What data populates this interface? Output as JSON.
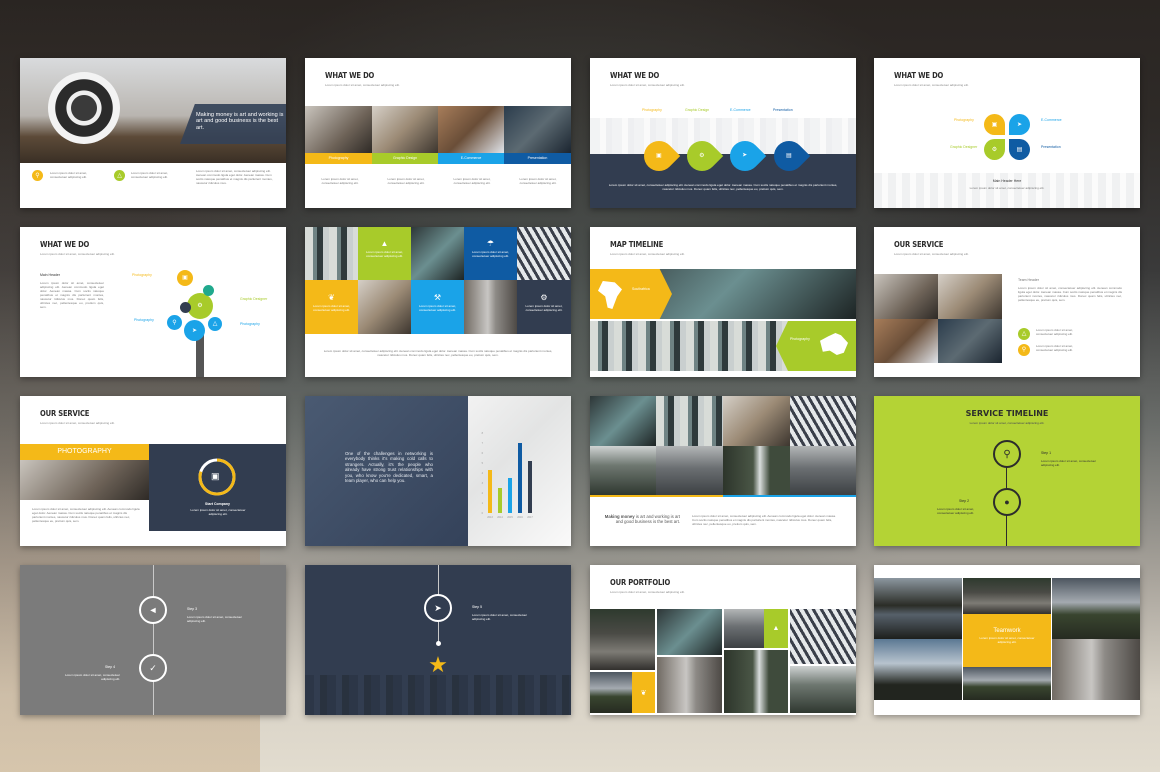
{
  "colors": {
    "yellow": "#f4b918",
    "green": "#a8cb2a",
    "light_blue": "#1aa3e8",
    "dark_blue": "#0f5ba3",
    "navy": "#323d50",
    "gray": "#7b7b7b",
    "lime_bg": "#b4d335"
  },
  "lorem_short": "Lorem ipsum dolor sit amet, consectetuer adipiscing elit.",
  "lorem_block": "Lorem ipsum dolor sit amet, consectetuer adipiscing elit. Aenean commodo ligula eget dolor. Aenean massa. Cum sociis natoque penatibus et magnis dis parturient montes, nascetur ridiculus mus. Donec quam felis, ultricies nec, pellentesque eu, pretium quis, sem.",
  "slides": {
    "s1": {
      "headline": "Making money is art and working is art and good business is the best art.",
      "items": [
        {
          "icon": "search-icon",
          "text": "Lorem ipsum dolor sit amet, consectetuer adipiscing elit."
        },
        {
          "icon": "bell-icon",
          "text": "Lorem ipsum dolor sit amet, consectetuer adipiscing elit."
        }
      ],
      "paragraph": "Lorem ipsum dolor sit amet, consectetuer adipiscing elit. Aenean commodo ligula eget dolor. Aenean massa. Cum sociis natoque penatibus et magnis dis parturient montes, nascetur ridiculus mus."
    },
    "s2": {
      "title": "WHAT WE DO",
      "subtitle": "Lorem ipsum dolor sit amet, consectetuer adipiscing elit.",
      "tabs": [
        {
          "label": "Photography",
          "text": "Lorem ipsum dolor sit amet, consectetuer adipiscing elit."
        },
        {
          "label": "Graphic Design",
          "text": "Lorem ipsum dolor sit amet, consectetuer adipiscing elit."
        },
        {
          "label": "E-Commerce",
          "text": "Lorem ipsum dolor sit amet, consectetuer adipiscing elit."
        },
        {
          "label": "Presentation",
          "text": "Lorem ipsum dolor sit amet, consectetuer adipiscing elit."
        }
      ]
    },
    "s3": {
      "title": "WHAT WE DO",
      "subtitle": "Lorem ipsum dolor sit amet, consectetuer adipiscing elit.",
      "steps": [
        {
          "label": "Photography",
          "icon": "camera-icon"
        },
        {
          "label": "Graphic Design",
          "icon": "gear-icon"
        },
        {
          "label": "E-Commerce",
          "icon": "paper-plane-icon"
        },
        {
          "label": "Presentation",
          "icon": "film-icon"
        }
      ],
      "step_text": "Lorem ipsum dolor sit amet, consectetuer adipiscing elit."
    },
    "s4": {
      "title": "WHAT WE DO",
      "subtitle": "Lorem ipsum dolor sit amet, consectetuer adipiscing elit.",
      "items": [
        "Photography",
        "E-Commerce",
        "Graphic Designer",
        "Presentation"
      ],
      "main_header": "Main Header Here"
    },
    "s5": {
      "title": "WHAT WE DO",
      "subtitle": "Lorem ipsum dolor sit amet, consectetuer adipiscing elit.",
      "main_header": "Main Header",
      "labels": [
        "Photography",
        "Graphic Designer",
        "Photography",
        "Photography"
      ]
    },
    "s6": {
      "tiles_text": "Lorem ipsum dolor sit amet, consectetuer adipiscing elit."
    },
    "s7": {
      "title": "MAP TIMELINE",
      "subtitle": "Lorem ipsum dolor sit amet, consectetuer adipiscing elit.",
      "regions": [
        {
          "label": "Southafrica",
          "map": "africa-map-icon"
        },
        {
          "label": "Photography",
          "map": "australia-map-icon"
        }
      ]
    },
    "s8": {
      "title": "OUR SERVICE",
      "subtitle": "Lorem ipsum dolor sit amet, consectetuer adipiscing elit.",
      "team_header": "Team Header"
    },
    "s9": {
      "title": "OUR SERVICE",
      "subtitle": "Lorem ipsum dolor sit amet, consectetuer adipiscing elit.",
      "banner": "PHOTOGRAPHY",
      "company": "Start Company",
      "progress_fraction": 0.8
    },
    "s10": {
      "quote": "One of the challenges in networking is everybody thinks it's making cold calls to strangers. Actually, it's the people who already have strong trust relationships with you, who know you're dedicated, smart, a team player, who can help you."
    },
    "s11": {
      "headline_bold": "Making money",
      "headline_rest": " is art and working is art and good business is the best art."
    },
    "s12": {
      "title": "SERVICE TIMELINE",
      "subtitle": "Lorem ipsum dolor sit amet, consectetuer adipiscing elit.",
      "steps": [
        "Step 1",
        "Step 2"
      ]
    },
    "s13": {
      "steps": [
        "Step 3",
        "Step 4"
      ]
    },
    "s14": {
      "steps": [
        "Step 5"
      ]
    },
    "s15": {
      "title": "OUR PORTFOLIO",
      "subtitle": "Lorem ipsum dolor sit amet, consectetuer adipiscing elit."
    },
    "s16": {
      "label": "Teamwork"
    }
  },
  "chart_data": {
    "type": "bar",
    "categories": [
      "2013",
      "2014",
      "2015",
      "2016",
      "2017"
    ],
    "values": [
      4.3,
      2.5,
      3.5,
      7.0,
      5.2
    ],
    "colors": [
      "#f4b918",
      "#a8cb2a",
      "#1aa3e8",
      "#0f5ba3",
      "#323d50"
    ],
    "title": "",
    "xlabel": "",
    "ylabel": "",
    "ylim": [
      0,
      8
    ],
    "grid": false
  }
}
